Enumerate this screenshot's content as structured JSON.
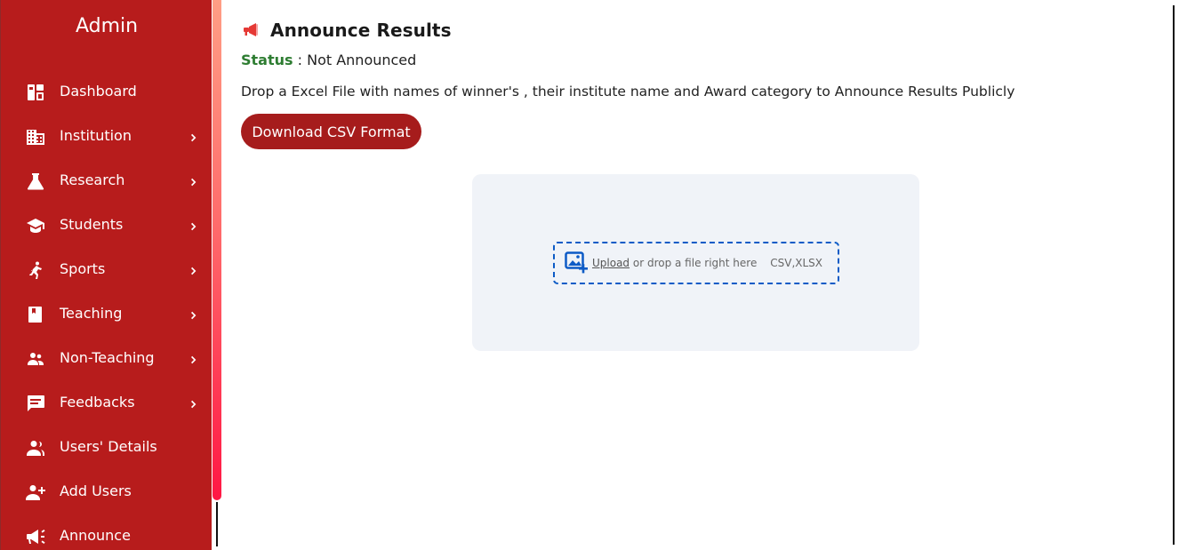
{
  "sidebar": {
    "title": "Admin",
    "items": [
      {
        "label": "Dashboard",
        "icon": "dashboard-icon",
        "has_submenu": false
      },
      {
        "label": "Institution",
        "icon": "building-icon",
        "has_submenu": true
      },
      {
        "label": "Research",
        "icon": "flask-icon",
        "has_submenu": true
      },
      {
        "label": "Students",
        "icon": "graduation-cap-icon",
        "has_submenu": true
      },
      {
        "label": "Sports",
        "icon": "sports-icon",
        "has_submenu": true
      },
      {
        "label": "Teaching",
        "icon": "book-icon",
        "has_submenu": true
      },
      {
        "label": "Non-Teaching",
        "icon": "people-icon",
        "has_submenu": true
      },
      {
        "label": "Feedbacks",
        "icon": "feedback-icon",
        "has_submenu": true
      },
      {
        "label": "Users' Details",
        "icon": "users-icon",
        "has_submenu": false
      },
      {
        "label": "Add Users",
        "icon": "add-user-icon",
        "has_submenu": false
      },
      {
        "label": "Announce",
        "icon": "megaphone-icon",
        "has_submenu": false
      }
    ]
  },
  "main": {
    "title": "Announce Results",
    "status_label": "Status",
    "status_separator": " : ",
    "status_value": "Not Announced",
    "description": "Drop a Excel File with names of winner's , their institute name and Award category to Announce Results Publicly",
    "download_button": "Download CSV Format",
    "upload": {
      "link_text": "Upload",
      "hint_text": " or drop a file right here",
      "types": "CSV,XLSX"
    }
  },
  "colors": {
    "sidebar_bg": "#b71c1c",
    "button_bg": "#a61c1c",
    "status_green": "#2e7d32",
    "dropzone_border": "#0d5bc6",
    "upload_panel_bg": "#f0f3f8"
  }
}
